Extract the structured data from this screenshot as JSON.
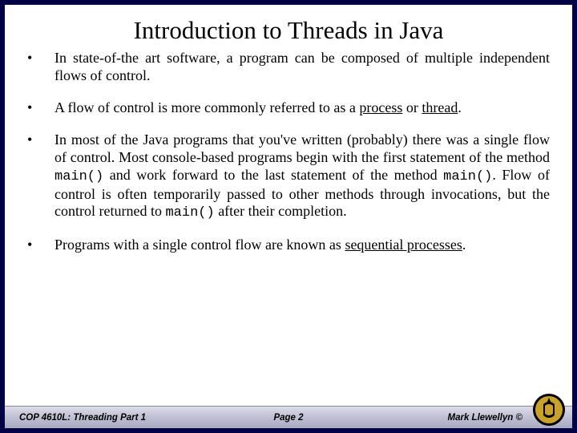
{
  "title": "Introduction to Threads in Java",
  "bullets": {
    "b1": "In state-of-the art software, a program can be composed of multiple independent flows of control.",
    "b2_a": "A flow of control is more commonly referred to as a ",
    "b2_process": "process",
    "b2_or": " or ",
    "b2_thread": "thread",
    "b2_end": ".",
    "b3_a": "In most of the Java programs that you've written (probably) there was a single flow of control.  Most console-based programs begin with the first statement of the method ",
    "b3_main1": "main()",
    "b3_b": " and work forward to the last statement of the method ",
    "b3_main2": "main()",
    "b3_c": ".  Flow of control is often temporarily passed to other methods through invocations, but the control returned to ",
    "b3_main3": "main()",
    "b3_d": " after their completion.",
    "b4_a": "Programs with a single control flow are known as ",
    "b4_seq": "sequential processes",
    "b4_end": "."
  },
  "footer": {
    "left": "COP 4610L: Threading Part 1",
    "center": "Page 2",
    "right": "Mark Llewellyn ©"
  }
}
